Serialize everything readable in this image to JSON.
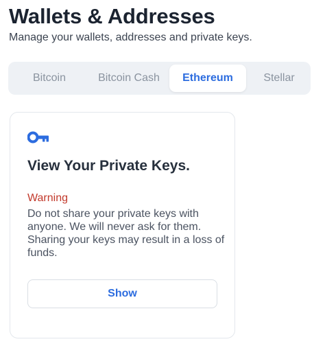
{
  "header": {
    "title": "Wallets & Addresses",
    "subtitle": "Manage your wallets, addresses and private keys."
  },
  "tabs": [
    {
      "label": "Bitcoin",
      "active": false
    },
    {
      "label": "Bitcoin Cash",
      "active": false
    },
    {
      "label": "Ethereum",
      "active": true
    },
    {
      "label": "Stellar",
      "active": false
    }
  ],
  "card": {
    "icon": "key-icon",
    "title": "View Your Private Keys.",
    "warning_label": "Warning",
    "warning_text": "Do not share your private keys with anyone. We will never ask for them. Sharing your keys may result in a loss of funds.",
    "show_label": "Show"
  },
  "colors": {
    "accent": "#2c6cdf",
    "warning": "#c2392b",
    "tab_bar_bg": "#eef1f5",
    "muted_text": "#8a939f"
  }
}
